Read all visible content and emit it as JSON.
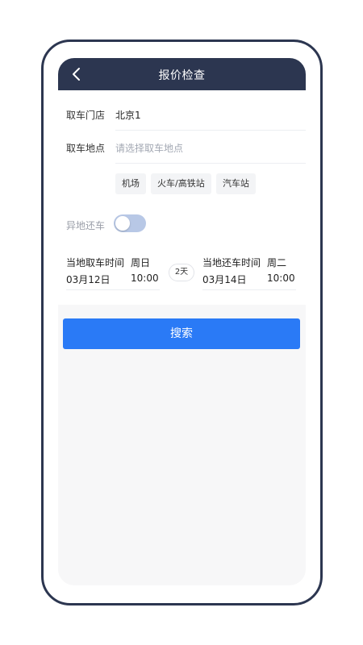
{
  "header": {
    "title": "报价检查"
  },
  "form": {
    "pickup_store_label": "取车门店",
    "pickup_store_value": "北京1",
    "pickup_location_label": "取车地点",
    "pickup_location_placeholder": "请选择取车地点",
    "chips": [
      "机场",
      "火车/高铁站",
      "汽车站"
    ],
    "diff_return_label": "异地还车",
    "diff_return_enabled": false
  },
  "schedule": {
    "pickup_label": "当地取车时间",
    "pickup_weekday": "周日",
    "pickup_date": "03月12日",
    "pickup_time": "10:00",
    "duration": "2天",
    "return_label": "当地还车时间",
    "return_weekday": "周二",
    "return_date": "03月14日",
    "return_time": "10:00"
  },
  "search_button_label": "搜索",
  "colors": {
    "header_bg": "#2c3650",
    "accent": "#2a7af6",
    "toggle_off": "#b8c8e6"
  }
}
